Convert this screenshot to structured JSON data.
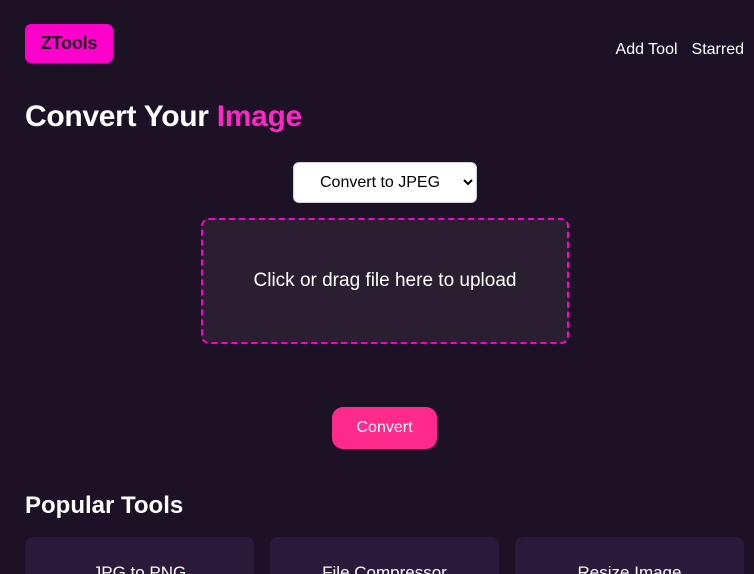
{
  "header": {
    "logo_label": "ZTools",
    "nav": {
      "add_tool": "Add Tool",
      "starred": "Starred"
    }
  },
  "main": {
    "title_prefix": "Convert Your",
    "title_accent": "Image",
    "format_select": {
      "selected": "Convert to JPEG"
    },
    "dropzone_text": "Click or drag file here to upload",
    "convert_label": "Convert"
  },
  "popular": {
    "title": "Popular Tools",
    "cards": [
      {
        "label": "JPG to PNG"
      },
      {
        "label": "File Compressor"
      },
      {
        "label": "Resize Image"
      }
    ]
  },
  "colors": {
    "background": "#1c1125",
    "brand_pink": "#ff00cc",
    "title_accent": "#ff26c7",
    "convert_button": "#ff2a8c",
    "dropzone_bg": "#291f31",
    "card_bg": "#2b1a3a"
  }
}
